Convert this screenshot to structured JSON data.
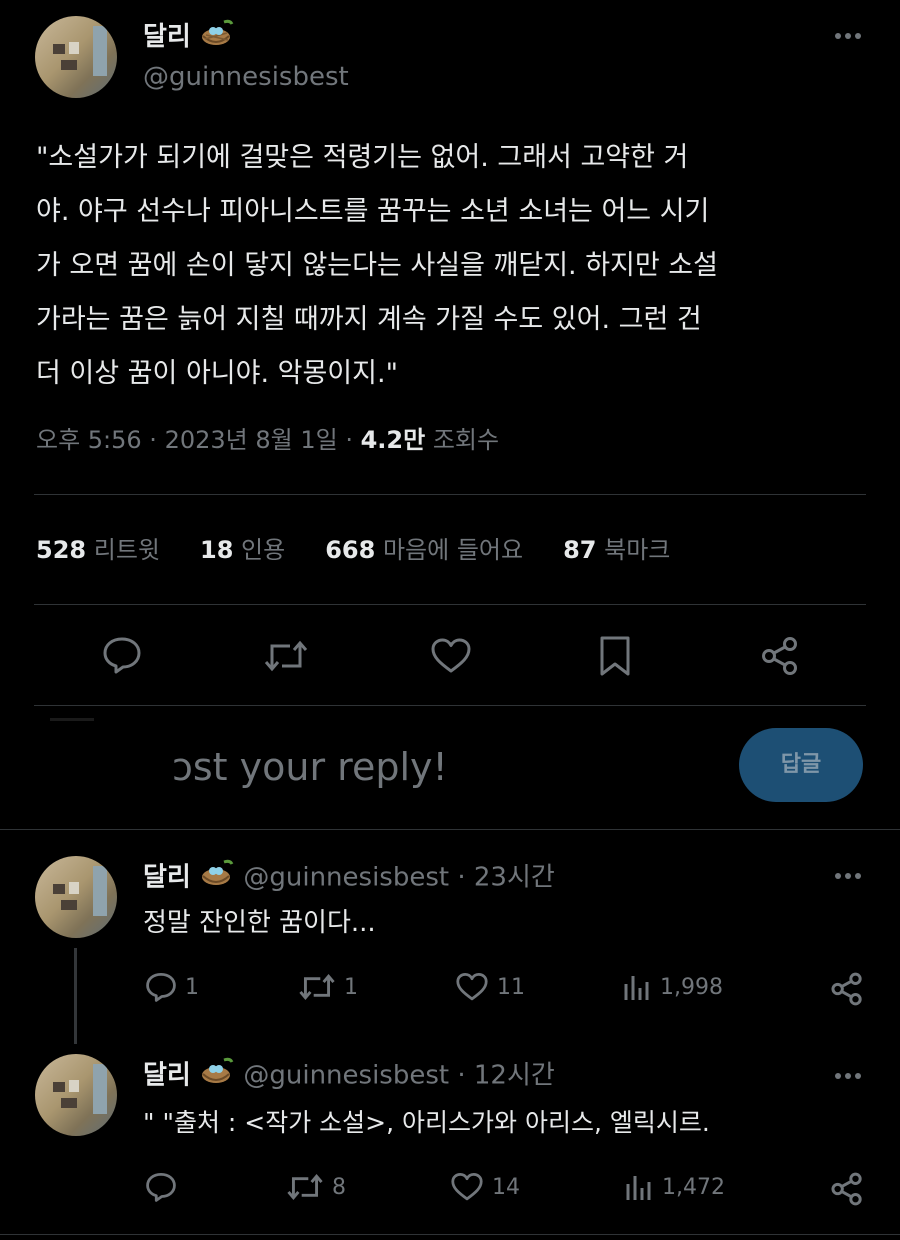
{
  "main_tweet": {
    "display_name": "달리",
    "handle": "@guinnesisbest",
    "more_icon": "more-dots-icon",
    "text_lines": [
      "\"소설가가 되기에 걸맞은 적령기는 없어. 그래서 고약한 거",
      "야. 야구 선수나 피아니스트를 꿈꾸는 소년 소녀는 어느 시기",
      "가 오면 꿈에 손이 닿지 않는다는 사실을 깨닫지. 하지만 소설",
      "가라는 꿈은 늙어 지칠 때까지 계속 가질 수도 있어. 그런 건",
      "더 이상 꿈이 아니야. 악몽이지.\""
    ],
    "time": "오후 5:56 · 2023년 8월 1일 ·",
    "views_count": "4.2만",
    "views_label": "조회수",
    "stats": [
      {
        "count": "528",
        "label": "리트윗"
      },
      {
        "count": "18",
        "label": "인용"
      },
      {
        "count": "668",
        "label": "마음에 들어요"
      },
      {
        "count": "87",
        "label": "북마크"
      }
    ],
    "actions": [
      "reply-icon",
      "retweet-icon",
      "like-icon",
      "bookmark-icon",
      "share-icon"
    ]
  },
  "composer": {
    "placeholder": "ɔst your reply!",
    "reply_button": "답글"
  },
  "replies": [
    {
      "display_name": "달리",
      "handle": "@guinnesisbest",
      "time": "· 23시간",
      "text": "정말 잔인한 꿈이다...",
      "reply_count": "1",
      "retweet_count": "1",
      "like_count": "11",
      "view_count": "1,998"
    },
    {
      "display_name": "달리",
      "handle": "@guinnesisbest",
      "time": "· 12시간",
      "text": "\" \"출처 : <작가 소설>, 아리스가와 아리스, 엘릭시르.",
      "reply_count": "",
      "retweet_count": "8",
      "like_count": "14",
      "view_count": "1,472"
    }
  ],
  "colors": {
    "background": "#000000",
    "text": "#e7e9ea",
    "muted": "#71767b",
    "divider": "#2f3336",
    "reply_button_bg": "#1d4f74"
  }
}
